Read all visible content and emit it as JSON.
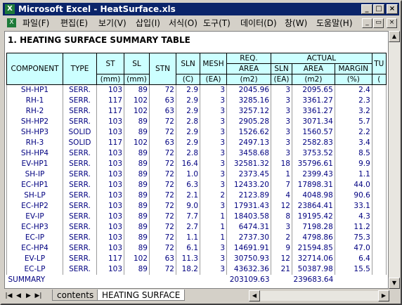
{
  "window": {
    "title": "Microsoft Excel - HeatSurface.xls",
    "app_icon": "X"
  },
  "title_buttons": [
    "_",
    "□",
    "×"
  ],
  "menu": {
    "items": [
      "파일(F)",
      "편집(E)",
      "보기(V)",
      "삽입(I)",
      "서식(O)",
      "도구(T)",
      "데이터(D)",
      "창(W)",
      "도움말(H)"
    ],
    "doc_buttons": [
      "_",
      "▭",
      "×"
    ]
  },
  "sheet": {
    "title": "1. HEATING SURFACE SUMMARY TABLE",
    "headers": {
      "component": "COMPONENT",
      "type": "TYPE",
      "st": "ST",
      "sl": "SL",
      "stn": "STN",
      "sln": "SLN",
      "mesh": "MESH",
      "req": "REQ.",
      "area": "AREA",
      "actual": "ACTUAL",
      "actual_sln": "SLN",
      "actual_area": "AREA",
      "margin": "MARGIN",
      "tu": "TU",
      "u_mm1": "(mm)",
      "u_mm2": "(mm)",
      "u_c": "(C)",
      "u_ea": "(EA)",
      "u_m2": "(m2)",
      "u_ea2": "(EA)",
      "u_m2b": "(m2)",
      "u_pct": "(%)",
      "u_tu": "("
    },
    "rows": [
      [
        "SH-HP1",
        "SERR.",
        "103",
        "89",
        "72",
        "2.9",
        "3",
        "2045.96",
        "3",
        "2095.65",
        "2.4"
      ],
      [
        "RH-1",
        "SERR.",
        "117",
        "102",
        "63",
        "2.9",
        "3",
        "3285.16",
        "3",
        "3361.27",
        "2.3"
      ],
      [
        "RH-2",
        "SERR.",
        "117",
        "102",
        "63",
        "2.9",
        "3",
        "3257.12",
        "3",
        "3361.27",
        "3.2"
      ],
      [
        "SH-HP2",
        "SERR.",
        "103",
        "89",
        "72",
        "2.8",
        "3",
        "2905.28",
        "3",
        "3071.34",
        "5.7"
      ],
      [
        "SH-HP3",
        "SOLID",
        "103",
        "89",
        "72",
        "2.9",
        "3",
        "1526.62",
        "3",
        "1560.57",
        "2.2"
      ],
      [
        "RH-3",
        "SOLID",
        "117",
        "102",
        "63",
        "2.9",
        "3",
        "2497.13",
        "3",
        "2582.83",
        "3.4"
      ],
      [
        "SH-HP4",
        "SERR.",
        "103",
        "89",
        "72",
        "2.8",
        "3",
        "3458.68",
        "3",
        "3753.52",
        "8.5"
      ],
      [
        "EV-HP1",
        "SERR.",
        "103",
        "89",
        "72",
        "16.4",
        "3",
        "32581.32",
        "18",
        "35796.61",
        "9.9"
      ],
      [
        "SH-IP",
        "SERR.",
        "103",
        "89",
        "72",
        "1.0",
        "3",
        "2373.45",
        "1",
        "2399.43",
        "1.1"
      ],
      [
        "EC-HP1",
        "SERR.",
        "103",
        "89",
        "72",
        "6.3",
        "3",
        "12433.20",
        "7",
        "17898.31",
        "44.0"
      ],
      [
        "SH-LP",
        "SERR.",
        "103",
        "89",
        "72",
        "2.1",
        "2",
        "2123.89",
        "4",
        "4048.98",
        "90.6"
      ],
      [
        "EC-HP2",
        "SERR.",
        "103",
        "89",
        "72",
        "9.0",
        "3",
        "17931.43",
        "12",
        "23864.41",
        "33.1"
      ],
      [
        "EV-IP",
        "SERR.",
        "103",
        "89",
        "72",
        "7.7",
        "1",
        "18403.58",
        "8",
        "19195.42",
        "4.3"
      ],
      [
        "EC-HP3",
        "SERR.",
        "103",
        "89",
        "72",
        "2.7",
        "1",
        "6474.31",
        "3",
        "7198.28",
        "11.2"
      ],
      [
        "EC-IP",
        "SERR.",
        "103",
        "89",
        "72",
        "1.1",
        "1",
        "2737.30",
        "2",
        "4798.86",
        "75.3"
      ],
      [
        "EC-HP4",
        "SERR.",
        "103",
        "89",
        "72",
        "6.1",
        "3",
        "14691.91",
        "9",
        "21594.85",
        "47.0"
      ],
      [
        "EV-LP",
        "SERR.",
        "117",
        "102",
        "63",
        "11.3",
        "3",
        "30750.93",
        "12",
        "32714.06",
        "6.4"
      ],
      [
        "EC-LP",
        "SERR.",
        "103",
        "89",
        "72",
        "18.2",
        "3",
        "43632.36",
        "21",
        "50387.98",
        "15.5"
      ]
    ],
    "summary": {
      "label": "SUMMARY",
      "req_total": "203109.63",
      "actual_total": "239683.64"
    }
  },
  "tabs": {
    "sheets": [
      "contents",
      "HEATING SURFACE"
    ],
    "active": 1
  },
  "colors": {
    "header_bg": "#ccffff",
    "cell_text": "#000080",
    "titlebar": "#0a246a"
  }
}
